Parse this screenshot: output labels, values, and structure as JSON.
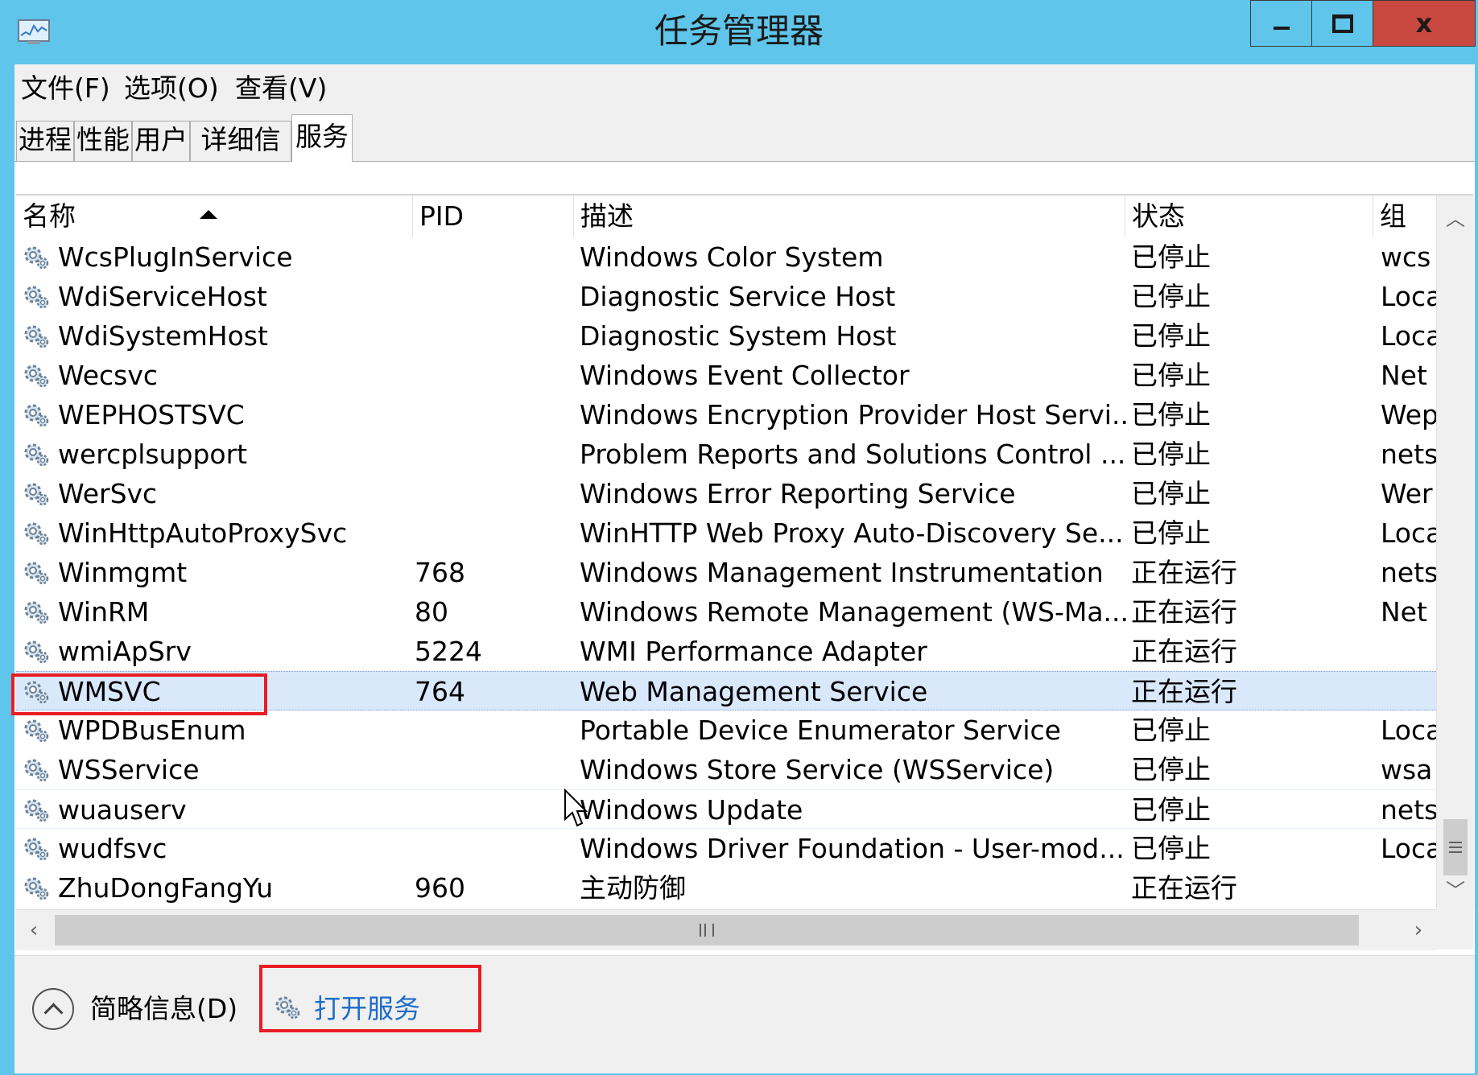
{
  "window": {
    "title": "任务管理器",
    "close_glyph": "x"
  },
  "menu": {
    "file": "文件(F)",
    "options": "选项(O)",
    "view": "查看(V)"
  },
  "tabs": [
    "进程",
    "性能",
    "用户",
    "详细信息",
    "服务"
  ],
  "active_tab": "服务",
  "columns": {
    "name": "名称",
    "pid": "PID",
    "desc": "描述",
    "status": "状态",
    "group": "组"
  },
  "sort": {
    "column": "名称",
    "direction": "ascending"
  },
  "rows": [
    {
      "name": "WcsPlugInService",
      "pid": "",
      "desc": "Windows Color System",
      "status": "已停止",
      "group": "wcs"
    },
    {
      "name": "WdiServiceHost",
      "pid": "",
      "desc": "Diagnostic Service Host",
      "status": "已停止",
      "group": "Loca"
    },
    {
      "name": "WdiSystemHost",
      "pid": "",
      "desc": "Diagnostic System Host",
      "status": "已停止",
      "group": "Loca"
    },
    {
      "name": "Wecsvc",
      "pid": "",
      "desc": "Windows Event Collector",
      "status": "已停止",
      "group": "Net"
    },
    {
      "name": "WEPHOSTSVC",
      "pid": "",
      "desc": "Windows Encryption Provider Host Servi...",
      "status": "已停止",
      "group": "Wep"
    },
    {
      "name": "wercplsupport",
      "pid": "",
      "desc": "Problem Reports and Solutions Control ...",
      "status": "已停止",
      "group": "nets"
    },
    {
      "name": "WerSvc",
      "pid": "",
      "desc": "Windows Error Reporting Service",
      "status": "已停止",
      "group": "Wer"
    },
    {
      "name": "WinHttpAutoProxySvc",
      "pid": "",
      "desc": "WinHTTP Web Proxy Auto-Discovery Se...",
      "status": "已停止",
      "group": "Loca"
    },
    {
      "name": "Winmgmt",
      "pid": "768",
      "desc": "Windows Management Instrumentation",
      "status": "正在运行",
      "group": "nets"
    },
    {
      "name": "WinRM",
      "pid": "80",
      "desc": "Windows Remote Management (WS-Ma...",
      "status": "正在运行",
      "group": "Net"
    },
    {
      "name": "wmiApSrv",
      "pid": "5224",
      "desc": "WMI Performance Adapter",
      "status": "正在运行",
      "group": ""
    },
    {
      "name": "WMSVC",
      "pid": "764",
      "desc": "Web Management Service",
      "status": "正在运行",
      "group": ""
    },
    {
      "name": "WPDBusEnum",
      "pid": "",
      "desc": "Portable Device Enumerator Service",
      "status": "已停止",
      "group": "Loca"
    },
    {
      "name": "WSService",
      "pid": "",
      "desc": "Windows Store Service (WSService)",
      "status": "已停止",
      "group": "wsa"
    },
    {
      "name": "wuauserv",
      "pid": "",
      "desc": "Windows Update",
      "status": "已停止",
      "group": "nets"
    },
    {
      "name": "wudfsvc",
      "pid": "",
      "desc": "Windows Driver Foundation - User-mod...",
      "status": "已停止",
      "group": "Loca"
    },
    {
      "name": "ZhuDongFangYu",
      "pid": "960",
      "desc": "主动防御",
      "status": "正在运行",
      "group": ""
    }
  ],
  "selected_row": "WMSVC",
  "hovered_row": "wuauserv",
  "footer": {
    "fewer_details": "简略信息(D)",
    "open_services": "打开服务"
  },
  "colors": {
    "titlebar": "#5fc5ea",
    "close": "#c9483f",
    "selected_row": "#d9e8fb",
    "link": "#1c6cc9",
    "highlight_box": "#ea1c24"
  }
}
